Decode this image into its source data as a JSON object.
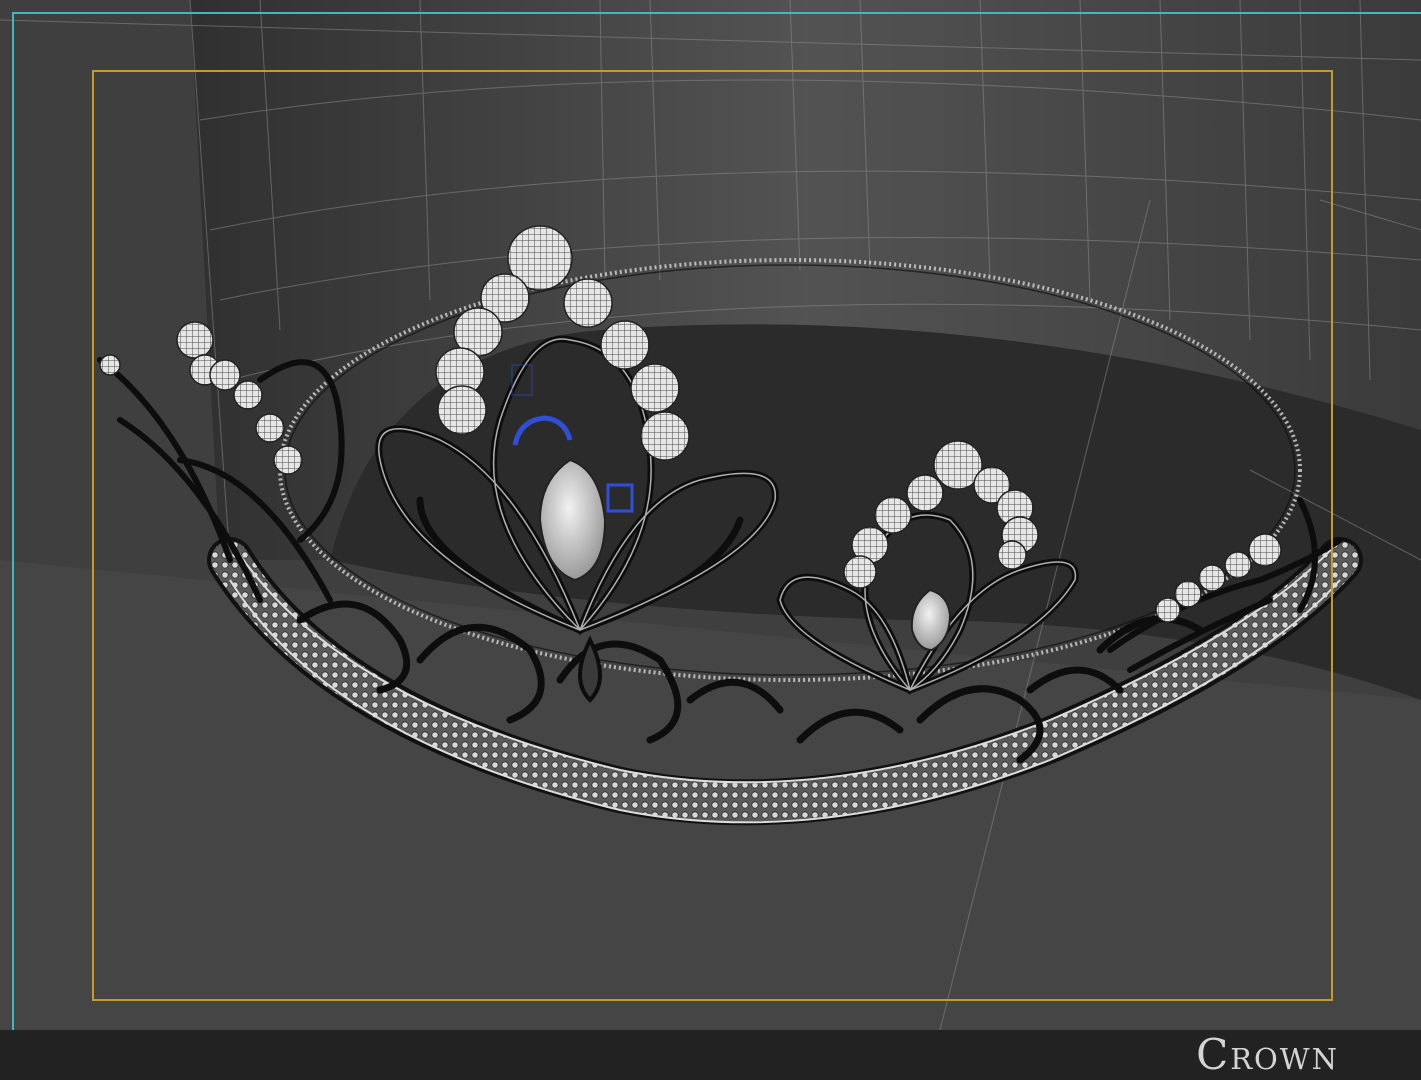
{
  "viewport": {
    "active_border_color": "#3fb8c4",
    "safe_frame_color": "#c89a28",
    "background_color": "#3c3c3c",
    "selection_color": "#2e4fd6"
  },
  "footer": {
    "title": "Crown"
  }
}
